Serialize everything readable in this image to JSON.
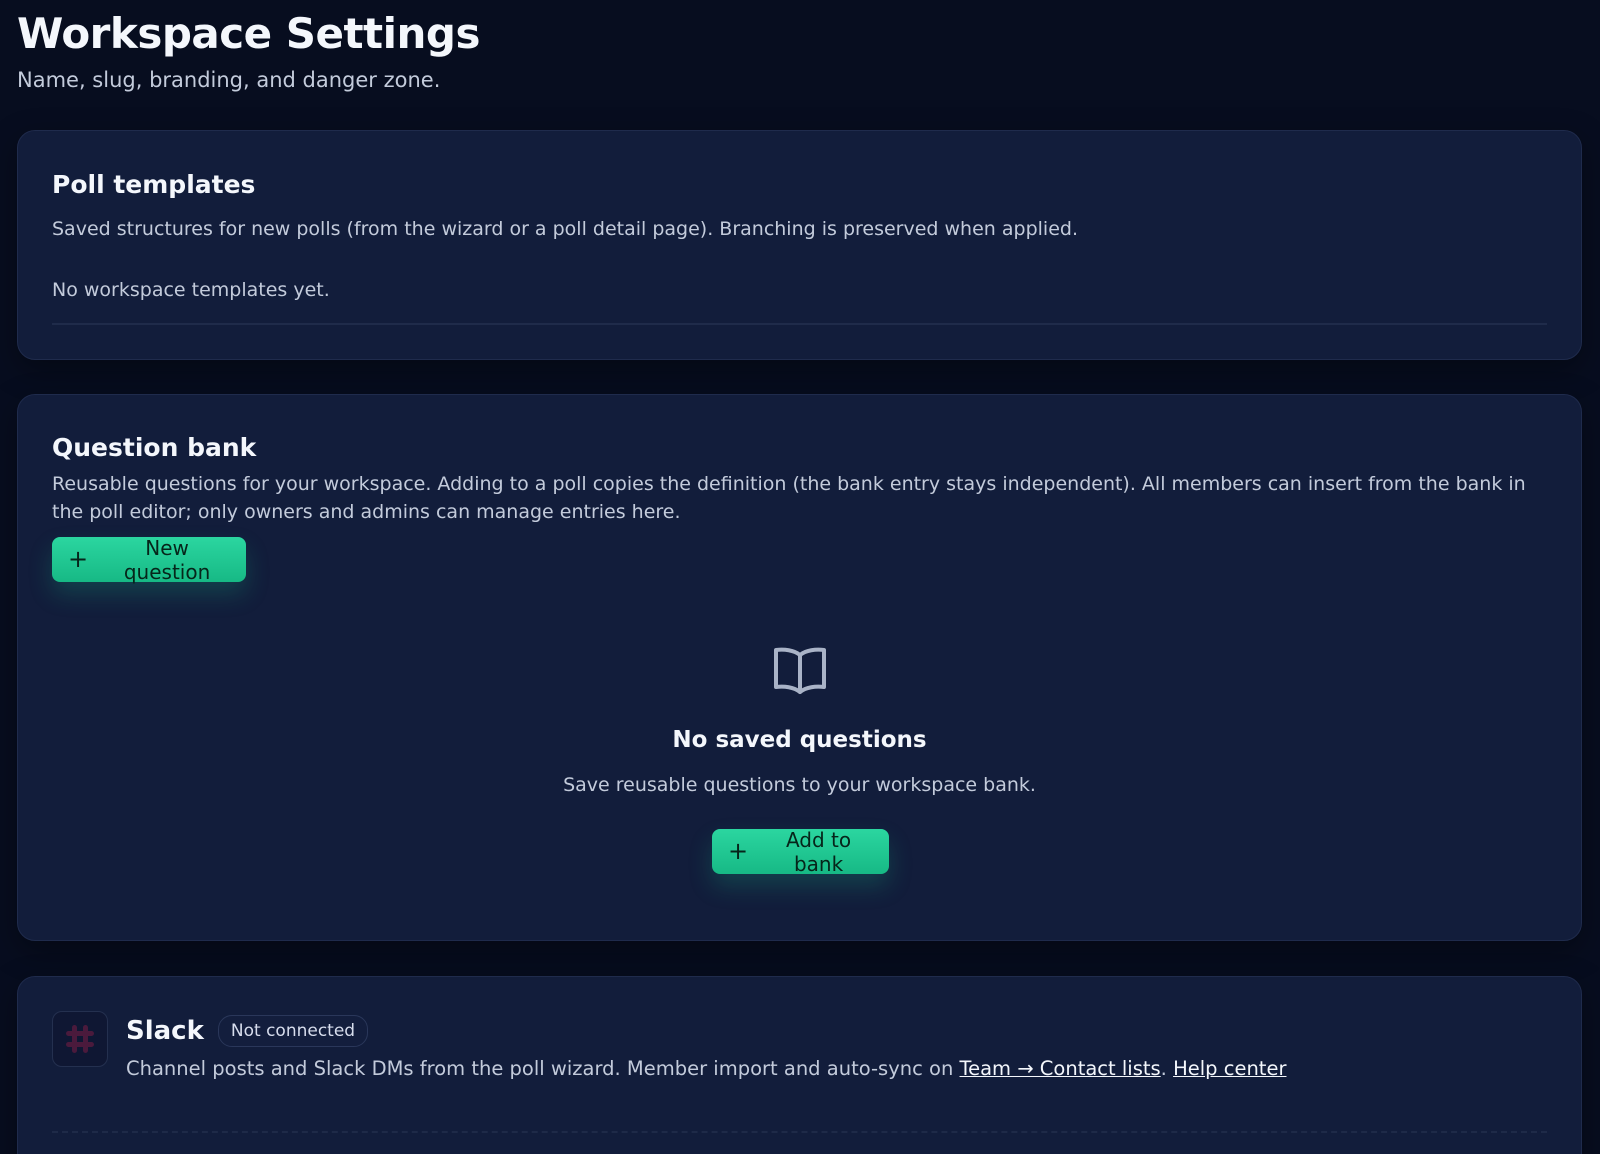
{
  "header": {
    "title": "Workspace Settings",
    "subtitle": "Name, slug, branding, and danger zone."
  },
  "templates": {
    "title": "Poll templates",
    "description": "Saved structures for new polls (from the wizard or a poll detail page). Branching is preserved when applied.",
    "empty_text": "No workspace templates yet."
  },
  "bank": {
    "title": "Question bank",
    "description": "Reusable questions for your workspace. Adding to a poll copies the definition (the bank entry stays independent). All members can insert from the bank in the poll editor; only owners and admins can manage entries here.",
    "new_button": "New question",
    "empty": {
      "icon": "book-open-icon",
      "title": "No saved questions",
      "description": "Save reusable questions to your workspace bank.",
      "add_button": "Add to bank"
    }
  },
  "slack": {
    "name": "Slack",
    "status": "Not connected",
    "description": "Channel posts and Slack DMs from the poll wizard. Member import and auto-sync on ",
    "link_team": "Team → Contact lists",
    "separator": ". ",
    "link_help": "Help center",
    "icon": "slack-logo-icon"
  },
  "colors": {
    "background": "#070d1f",
    "card": "#121d3b",
    "accent": "#1fc892",
    "slack_logo": "#4a1a3c"
  }
}
